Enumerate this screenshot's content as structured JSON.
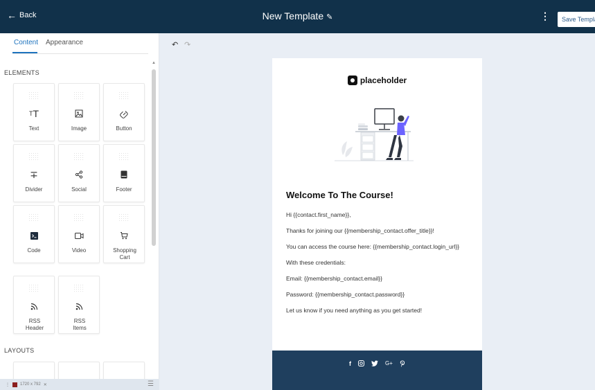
{
  "topbar": {
    "back_label": "Back",
    "title": "New Template",
    "save_label": "Save Template"
  },
  "sidebar": {
    "tabs": [
      {
        "label": "Content",
        "active": true
      },
      {
        "label": "Appearance",
        "active": false
      }
    ],
    "elements_heading": "ELEMENTS",
    "layouts_heading": "LAYOUTS",
    "elements": [
      {
        "label": "Text",
        "icon": "text-icon"
      },
      {
        "label": "Image",
        "icon": "image-icon"
      },
      {
        "label": "Button",
        "icon": "link-icon"
      },
      {
        "label": "Divider",
        "icon": "divider-icon"
      },
      {
        "label": "Social",
        "icon": "share-icon"
      },
      {
        "label": "Footer",
        "icon": "footer-icon"
      },
      {
        "label": "Code",
        "icon": "terminal-icon"
      },
      {
        "label": "Video",
        "icon": "video-icon"
      },
      {
        "label": "Shopping Cart",
        "icon": "cart-icon"
      },
      {
        "label": "RSS Header",
        "icon": "rss-icon"
      },
      {
        "label": "RSS Items",
        "icon": "rss-icon"
      }
    ],
    "debug_text": "1720 x 792"
  },
  "email": {
    "logo_text": "placeholder",
    "heading": "Welcome To The Course!",
    "lines": [
      "Hi {{contact.first_name}},",
      "Thanks for joining our {{membership_contact.offer_title}}!",
      "You can access the course here: {{membership_contact.login_url}}",
      "With these credentials:",
      "Email: {{membership_contact.email}}",
      "Password: {{membership_contact.password}}",
      "Let us know if you need anything as you get started!"
    ],
    "footer_socials": [
      "facebook-icon",
      "instagram-icon",
      "twitter-icon",
      "google-plus-icon",
      "pinterest-icon"
    ]
  },
  "colors": {
    "topbar": "#11314a",
    "accent": "#1e73be",
    "footer": "#1f3f5e",
    "canvas": "#e9eef5"
  }
}
